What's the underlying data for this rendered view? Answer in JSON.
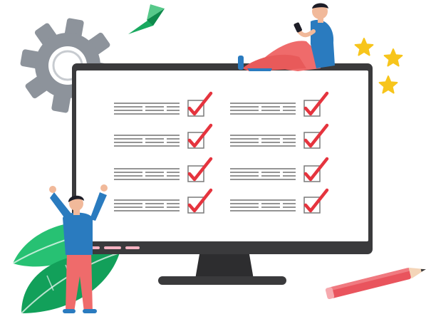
{
  "illustration": {
    "subject": "checklist-on-monitor",
    "icons": [
      "gear-icon",
      "paper-plane-icon",
      "star-icon",
      "leaf-icon",
      "pencil-icon",
      "checkmark-icon"
    ],
    "checklist": {
      "columns": 2,
      "rows_per_column": 4,
      "all_checked": true
    },
    "colors": {
      "monitor": "#3a3a3c",
      "screen": "#ffffff",
      "check": "#e5343e",
      "checkbox": "#7a7a7a",
      "text_lines": "#555555",
      "gear": "#8d939b",
      "gear_inner": "#c7cbd0",
      "plane": "#1aa960",
      "plane_light": "#57c98a",
      "stars": "#f7c51c",
      "leaf_dark": "#12a05a",
      "leaf_light": "#27c173",
      "person_shirt": "#2a7bbf",
      "person_pants": "#ef6b6b",
      "skin": "#f1b99a",
      "hair": "#1d1d27",
      "pencil_body": "#e9545d",
      "pencil_tip": "#f4d5b8",
      "screen_dots": "#f6b3c2"
    }
  }
}
